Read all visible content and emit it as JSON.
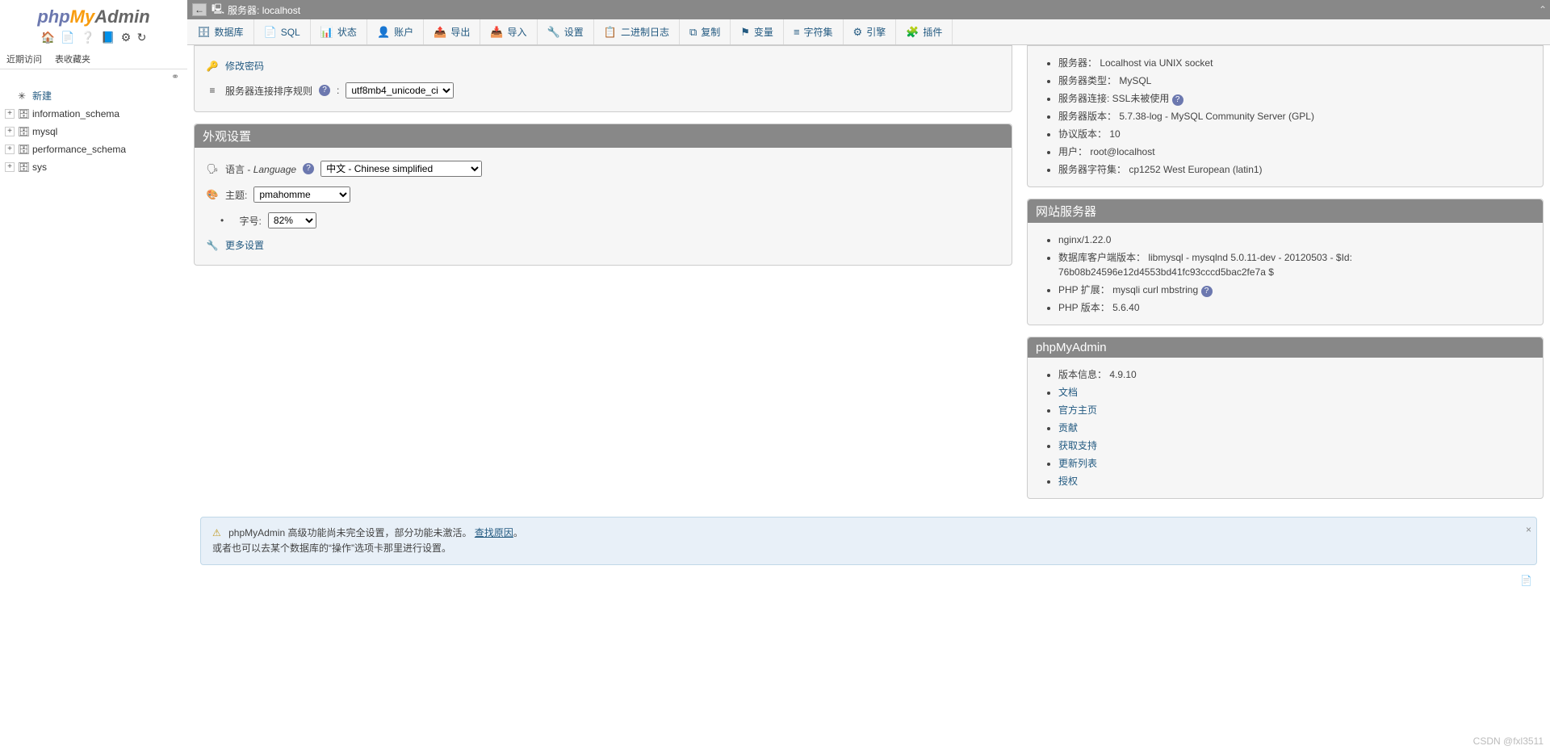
{
  "logo": {
    "p1": "php",
    "p2": "My",
    "p3": "Admin"
  },
  "nav_icons": [
    "🏠",
    "📄",
    "❔",
    "📘",
    "⚙",
    "↻"
  ],
  "nav_tabs": {
    "recent": "近期访问",
    "favorites": "表收藏夹"
  },
  "chain_icon": "⚭",
  "tree": {
    "new_label": "新建",
    "dbs": [
      "information_schema",
      "mysql",
      "performance_schema",
      "sys"
    ]
  },
  "topbar": {
    "back": "←",
    "server_prefix": "服务器:",
    "server": "localhost",
    "collapse": "⌃"
  },
  "tabs": [
    {
      "icon": "🗄",
      "label": "数据库"
    },
    {
      "icon": "📄",
      "label": "SQL"
    },
    {
      "icon": "📊",
      "label": "状态"
    },
    {
      "icon": "👤",
      "label": "账户"
    },
    {
      "icon": "📤",
      "label": "导出"
    },
    {
      "icon": "📥",
      "label": "导入"
    },
    {
      "icon": "🔧",
      "label": "设置"
    },
    {
      "icon": "📋",
      "label": "二进制日志"
    },
    {
      "icon": "⧉",
      "label": "复制"
    },
    {
      "icon": "⚑",
      "label": "变量"
    },
    {
      "icon": "≡",
      "label": "字符集"
    },
    {
      "icon": "⚙",
      "label": "引擎"
    },
    {
      "icon": "🧩",
      "label": "插件"
    }
  ],
  "general": {
    "change_pw": "修改密码",
    "collation_label": "服务器连接排序规则",
    "collation_value": "utf8mb4_unicode_ci"
  },
  "appearance": {
    "title": "外观设置",
    "lang_label": "语言",
    "lang_label_en": "Language",
    "lang_value": "中文 - Chinese simplified",
    "theme_label": "主题:",
    "theme_value": "pmahomme",
    "font_label": "字号:",
    "font_value": "82%",
    "more": "更多设置"
  },
  "db_server": {
    "items": [
      "服务器：  Localhost via UNIX socket",
      "服务器类型：  MySQL",
      "服务器连接:  SSL未被使用",
      "服务器版本：  5.7.38-log - MySQL Community Server (GPL)",
      "协议版本：  10",
      "用户：  root@localhost",
      "服务器字符集：  cp1252 West European (latin1)"
    ],
    "ssl_help": true
  },
  "web_server": {
    "title": "网站服务器",
    "items": [
      "nginx/1.22.0",
      "数据库客户端版本：  libmysql - mysqlnd 5.0.11-dev - 20120503 - $Id: 76b08b24596e12d4553bd41fc93cccd5bac2fe7a $",
      "PHP 扩展：  mysqli  curl  mbstring",
      "PHP 版本：  5.6.40"
    ]
  },
  "pma": {
    "title": "phpMyAdmin",
    "version_label": "版本信息：",
    "version": "4.9.10",
    "links": [
      "文档",
      "官方主页",
      "贡献",
      "获取支持",
      "更新列表",
      "授权"
    ]
  },
  "notice": {
    "line1_a": "phpMyAdmin 高级功能尚未完全设置，部分功能未激活。",
    "line1_link": "查找原因",
    "line1_b": "。",
    "line2": "或者也可以去某个数据库的“操作”选项卡那里进行设置。"
  },
  "pagebox": "📄",
  "watermark": "CSDN @fxl3511"
}
